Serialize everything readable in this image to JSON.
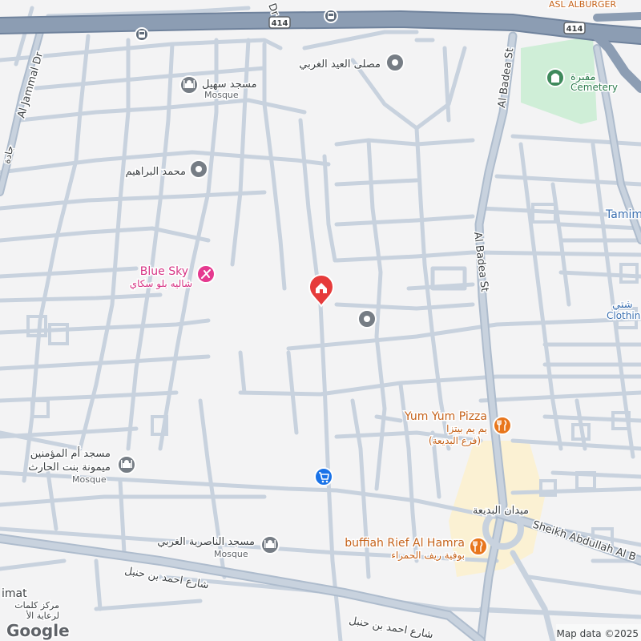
{
  "colors": {
    "background": "#f3f3f4",
    "street": "#c8d2de",
    "highway": "#8c9db3",
    "cemetery": "#cfeed7",
    "commercial": "#fbf1d3",
    "poi_gray": "#767d85",
    "recreation": "#e5398f",
    "food": "#e8761d",
    "shopping": "#1a73e8",
    "pin": "#e63b3b",
    "transit": "#5f6b7a",
    "text_dark": "#3c4043",
    "food_text": "#c5621a",
    "blue_text": "#3a6fb0"
  },
  "highway": {
    "shield_label": "414"
  },
  "streets": {
    "al_jammal": "Al Jammal Dr",
    "al_badea_upper": "Al Badea St",
    "al_badea_mid": "Al Badea St",
    "sheikh_abdullah": "Sheikh Abdullah Al B",
    "ahmed_bin_hanbal_1": "شارع احمد بن حنبل",
    "ahmed_bin_hanbal_2": "شارع احمد بن حنبل",
    "top_fragment": "Dr",
    "left_fragment": "جادة"
  },
  "pois": {
    "asl_alburger": {
      "label": "ASL ALBURGER",
      "icon": "food-icon"
    },
    "eid_prayer": {
      "label_ar": "مصلى العيد الغربي",
      "icon": "place-pin-icon"
    },
    "suhail_mosque": {
      "label_ar": "مسجد سهيل",
      "label_en": "Mosque",
      "icon": "mosque-icon"
    },
    "cemetery": {
      "label_ar": "مقبرة",
      "label_en": "Cemetery",
      "icon": "cemetery-icon"
    },
    "mohammed_ibrahim": {
      "label_ar": "محمد البراهيم",
      "icon": "place-pin-icon"
    },
    "blue_sky": {
      "label_en": "Blue Sky",
      "label_ar": "شاليه بلو سكاي",
      "icon": "recreation-icon"
    },
    "tamim": {
      "label": "Tamim"
    },
    "clothing": {
      "label_ar": "شتي",
      "label_en": "Clothin"
    },
    "yum_yum": {
      "label_en": "Yum Yum Pizza",
      "label_ar": "يم يم بيتزا",
      "label_ar2": "(فرع البديعة)",
      "icon": "restaurant-icon"
    },
    "umm_mosque": {
      "label_ar1": "مسجد أم المؤمنين",
      "label_ar2": "ميمونة بنت الحارث",
      "label_en": "Mosque",
      "icon": "mosque-icon"
    },
    "nasiriya_mosque": {
      "label_ar": "مسجد الناصرية الغربي",
      "label_en": "Mosque",
      "icon": "mosque-icon"
    },
    "badea_square": {
      "label_ar": "ميدان البديعة"
    },
    "buffiah": {
      "label_en": "buffiah Rief Al Hamra",
      "label_ar": "بوفية ريف الحمراء",
      "icon": "restaurant-icon"
    },
    "kalimat_center": {
      "label_1": "imat",
      "label_2": "مركز كلمات",
      "label_3": "لرعاية الأ"
    },
    "selected_place": {
      "icon": "home-pin-icon"
    },
    "shop": {
      "icon": "shopping-cart-icon"
    },
    "unnamed_place": {
      "icon": "place-pin-icon"
    }
  },
  "footer": {
    "logo": "Google",
    "map_data": "Map data ©2025"
  }
}
